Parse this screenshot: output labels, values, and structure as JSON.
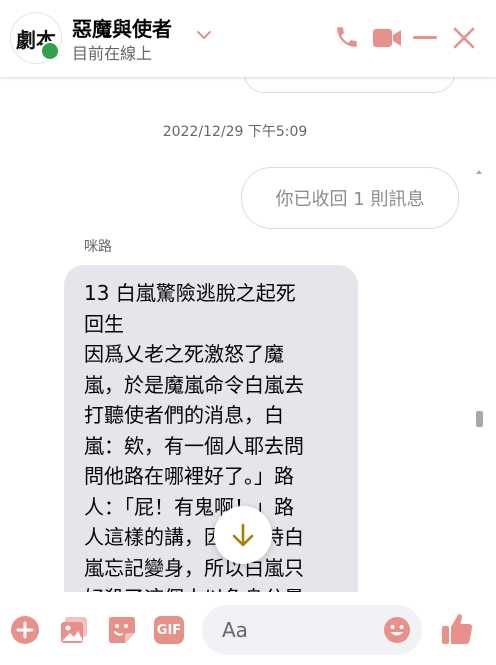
{
  "header": {
    "avatar_text": "劇本",
    "title": "惡魔與使者",
    "status": "目前在線上",
    "icons": [
      "chevron-down-icon",
      "phone-icon",
      "video-camera-icon",
      "minimize-icon",
      "close-icon"
    ],
    "accent_color": "#e8908a",
    "presence_color": "#31a24c"
  },
  "conversation": {
    "timestamp": "2022/12/29 下午5:09",
    "unsent_notice": "你已收回 1 則訊息",
    "sender": "咪路",
    "message": "13 白嵐驚險逃脫之起死\n回生\n因爲乂老之死激怒了魔\n嵐，於是魔嵐命令白嵐去\n打聽使者們的消息，白\n嵐：欸，有一個人耶去問\n問他路在哪裡好了。」路\n人：「屁！有鬼啊！」路\n人這樣的講，因爲當時白\n嵐忘記變身，所以白嵐只\n好殺了這個人以免身分暴"
  },
  "composer": {
    "placeholder": "Aa",
    "icons": [
      "plus-circle-icon",
      "photo-icon",
      "sticker-icon",
      "gif-icon",
      "emoji-icon",
      "thumbs-up-icon"
    ],
    "gif_label": "GIF"
  },
  "scroll_down_icon": "arrow-down-icon",
  "scroll_down_color": "#a58000"
}
